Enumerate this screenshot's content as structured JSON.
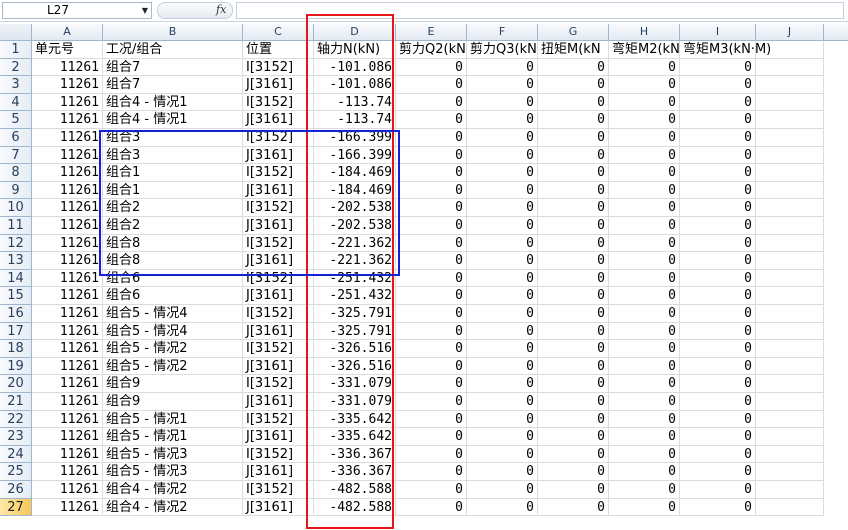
{
  "name_box": {
    "value": "L27"
  },
  "formula_bar": {
    "fx": "fx",
    "value": ""
  },
  "columns": [
    "A",
    "B",
    "C",
    "D",
    "E",
    "F",
    "G",
    "H",
    "I",
    "J"
  ],
  "row_numbers": [
    "1",
    "2",
    "3",
    "4",
    "5",
    "6",
    "7",
    "8",
    "9",
    "10",
    "11",
    "12",
    "13",
    "14",
    "15",
    "16",
    "17",
    "18",
    "19",
    "20",
    "21",
    "22",
    "23",
    "24",
    "25",
    "26",
    "27"
  ],
  "active_row": "27",
  "headers": [
    "单元号",
    "工况/组合",
    "位置",
    "轴力N(kN)",
    "剪力Q2(kN",
    "剪力Q3(kN",
    "扭矩M(kN",
    "弯矩M2(kN",
    "弯矩M3(kN·M)"
  ],
  "rows": [
    [
      "11261",
      "组合7",
      "I[3152]",
      "-101.086",
      "0",
      "0",
      "0",
      "0",
      "0"
    ],
    [
      "11261",
      "组合7",
      "J[3161]",
      "-101.086",
      "0",
      "0",
      "0",
      "0",
      "0"
    ],
    [
      "11261",
      "组合4 - 情况1",
      "I[3152]",
      "-113.74",
      "0",
      "0",
      "0",
      "0",
      "0"
    ],
    [
      "11261",
      "组合4 - 情况1",
      "J[3161]",
      "-113.74",
      "0",
      "0",
      "0",
      "0",
      "0"
    ],
    [
      "11261",
      "组合3",
      "I[3152]",
      "-166.399",
      "0",
      "0",
      "0",
      "0",
      "0"
    ],
    [
      "11261",
      "组合3",
      "J[3161]",
      "-166.399",
      "0",
      "0",
      "0",
      "0",
      "0"
    ],
    [
      "11261",
      "组合1",
      "I[3152]",
      "-184.469",
      "0",
      "0",
      "0",
      "0",
      "0"
    ],
    [
      "11261",
      "组合1",
      "J[3161]",
      "-184.469",
      "0",
      "0",
      "0",
      "0",
      "0"
    ],
    [
      "11261",
      "组合2",
      "I[3152]",
      "-202.538",
      "0",
      "0",
      "0",
      "0",
      "0"
    ],
    [
      "11261",
      "组合2",
      "J[3161]",
      "-202.538",
      "0",
      "0",
      "0",
      "0",
      "0"
    ],
    [
      "11261",
      "组合8",
      "I[3152]",
      "-221.362",
      "0",
      "0",
      "0",
      "0",
      "0"
    ],
    [
      "11261",
      "组合8",
      "J[3161]",
      "-221.362",
      "0",
      "0",
      "0",
      "0",
      "0"
    ],
    [
      "11261",
      "组合6",
      "I[3152]",
      "-251.432",
      "0",
      "0",
      "0",
      "0",
      "0"
    ],
    [
      "11261",
      "组合6",
      "J[3161]",
      "-251.432",
      "0",
      "0",
      "0",
      "0",
      "0"
    ],
    [
      "11261",
      "组合5 - 情况4",
      "I[3152]",
      "-325.791",
      "0",
      "0",
      "0",
      "0",
      "0"
    ],
    [
      "11261",
      "组合5 - 情况4",
      "J[3161]",
      "-325.791",
      "0",
      "0",
      "0",
      "0",
      "0"
    ],
    [
      "11261",
      "组合5 - 情况2",
      "I[3152]",
      "-326.516",
      "0",
      "0",
      "0",
      "0",
      "0"
    ],
    [
      "11261",
      "组合5 - 情况2",
      "J[3161]",
      "-326.516",
      "0",
      "0",
      "0",
      "0",
      "0"
    ],
    [
      "11261",
      "组合9",
      "I[3152]",
      "-331.079",
      "0",
      "0",
      "0",
      "0",
      "0"
    ],
    [
      "11261",
      "组合9",
      "J[3161]",
      "-331.079",
      "0",
      "0",
      "0",
      "0",
      "0"
    ],
    [
      "11261",
      "组合5 - 情况1",
      "I[3152]",
      "-335.642",
      "0",
      "0",
      "0",
      "0",
      "0"
    ],
    [
      "11261",
      "组合5 - 情况1",
      "J[3161]",
      "-335.642",
      "0",
      "0",
      "0",
      "0",
      "0"
    ],
    [
      "11261",
      "组合5 - 情况3",
      "I[3152]",
      "-336.367",
      "0",
      "0",
      "0",
      "0",
      "0"
    ],
    [
      "11261",
      "组合5 - 情况3",
      "J[3161]",
      "-336.367",
      "0",
      "0",
      "0",
      "0",
      "0"
    ],
    [
      "11261",
      "组合4 - 情况2",
      "I[3152]",
      "-482.588",
      "0",
      "0",
      "0",
      "0",
      "0"
    ],
    [
      "11261",
      "组合4 - 情况2",
      "J[3161]",
      "-482.588",
      "0",
      "0",
      "0",
      "0",
      "0"
    ]
  ],
  "highlight_colors": {
    "column_box": "#e8141b",
    "rows_box": "#1422d4",
    "active_row_header": "#f6c95b"
  }
}
